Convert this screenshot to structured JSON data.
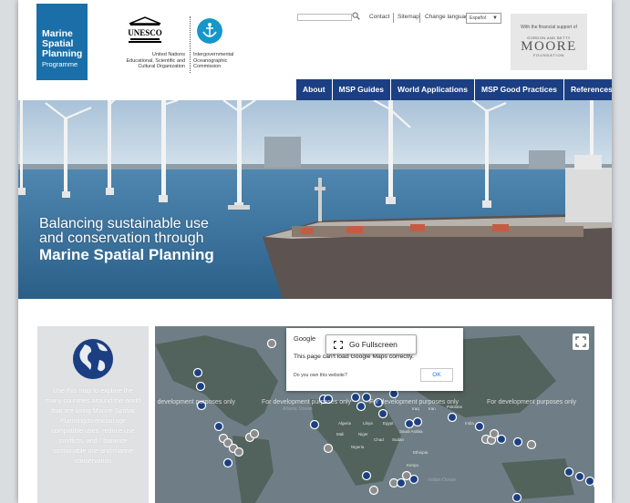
{
  "header": {
    "logo_lines": [
      "Marine",
      "Spatial",
      "Planning"
    ],
    "logo_sub": "Programme",
    "unesco_wordmark": "UNESCO",
    "unesco_caption": [
      "United Nations",
      "Educational, Scientific and",
      "Cultural Organization"
    ],
    "ioc_caption": [
      "Intergovernmental",
      "Oceanographic",
      "Commission"
    ],
    "top_links": [
      "Contact",
      "Sitemap",
      "Change language"
    ],
    "language_selected": "Español",
    "sponsor": {
      "support_text": "With the financial support of",
      "line1": "GORDON AND BETTY",
      "name": "MOORE",
      "line3": "FOUNDATION"
    }
  },
  "nav": {
    "items": [
      "About",
      "MSP Guides",
      "World Applications",
      "MSP Good Practices",
      "References"
    ],
    "color": "#1b3f82"
  },
  "hero": {
    "line1": "Balancing sustainable use",
    "line2": "and conservation through",
    "line3": "Marine Spatial Planning"
  },
  "info": {
    "text": "Use this map to explore the many countries around the world that are using Marine Spatial Planning to encourage compatible uses, reduce use conflicts, and \u0000balance sustainable use and marine conservation"
  },
  "map": {
    "watermark": "For development purposes only",
    "dialog": {
      "brand": "Google",
      "message": "This page can't load Google Maps correctly.",
      "question": "Do you own this website?",
      "ok_label": "OK"
    },
    "fullscreen_label": "Go Fullscreen",
    "ocean_labels": [
      "Atlantic Ocean",
      "Indian Ocean"
    ],
    "places": [
      "Algeria",
      "Libya",
      "Egypt",
      "Saudi Arabia",
      "Mali",
      "Niger",
      "Sudan",
      "Chad",
      "Pakistan",
      "India",
      "Iran",
      "Iraq",
      "Ethiopia",
      "Kenya",
      "Nigeria"
    ]
  }
}
